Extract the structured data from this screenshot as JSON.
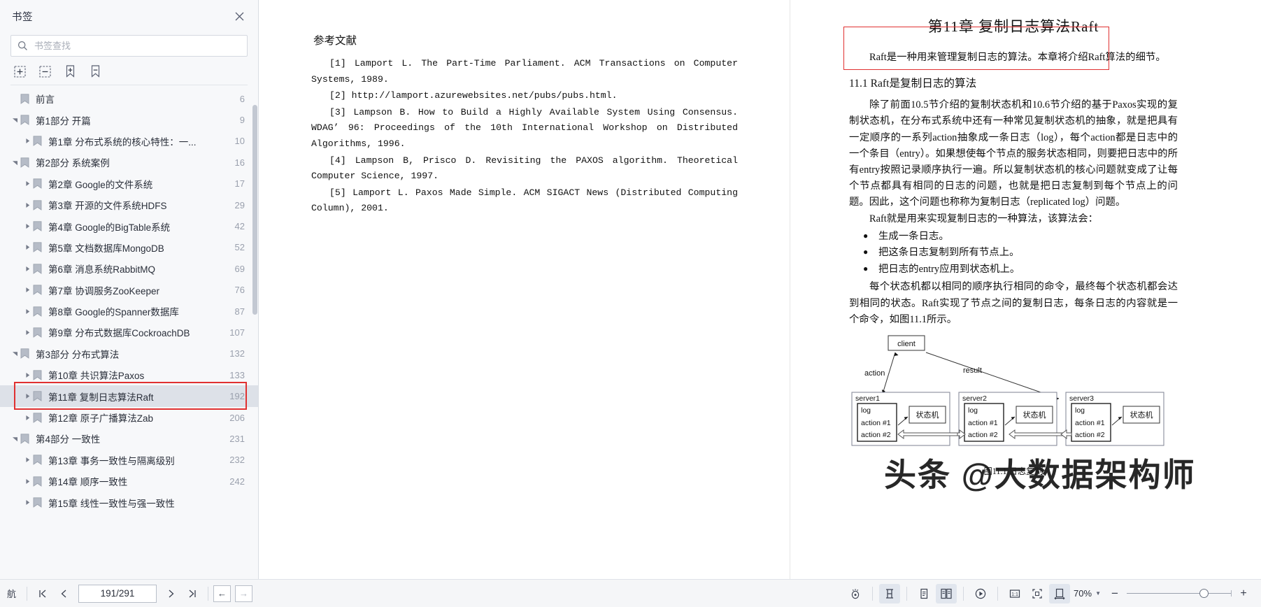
{
  "sidebar": {
    "title": "书签",
    "close_icon": "close-icon",
    "search": {
      "placeholder": "书签查找",
      "value": "",
      "icon": "search-icon"
    },
    "tools": [
      {
        "name": "expand-all-button",
        "icon": "box-plus-icon"
      },
      {
        "name": "collapse-all-button",
        "icon": "box-minus-icon"
      },
      {
        "name": "add-bookmark-button",
        "icon": "bookmark-plus-icon"
      },
      {
        "name": "remove-bookmark-button",
        "icon": "bookmark-minus-icon"
      }
    ],
    "items": [
      {
        "label": "前言",
        "page": "6",
        "level": 0,
        "twisty": "none",
        "selected": false
      },
      {
        "label": "第1部分 开篇",
        "page": "9",
        "level": 0,
        "twisty": "down",
        "selected": false
      },
      {
        "label": "第1章 分布式系统的核心特性：一...",
        "page": "10",
        "level": 2,
        "twisty": "right",
        "selected": false
      },
      {
        "label": "第2部分 系统案例",
        "page": "16",
        "level": 0,
        "twisty": "down",
        "selected": false
      },
      {
        "label": "第2章 Google的文件系统",
        "page": "17",
        "level": 2,
        "twisty": "right",
        "selected": false
      },
      {
        "label": "第3章 开源的文件系统HDFS",
        "page": "29",
        "level": 2,
        "twisty": "right",
        "selected": false
      },
      {
        "label": "第4章 Google的BigTable系统",
        "page": "42",
        "level": 2,
        "twisty": "right",
        "selected": false
      },
      {
        "label": "第5章 文档数据库MongoDB",
        "page": "52",
        "level": 2,
        "twisty": "right",
        "selected": false
      },
      {
        "label": "第6章 消息系统RabbitMQ",
        "page": "69",
        "level": 2,
        "twisty": "right",
        "selected": false
      },
      {
        "label": "第7章 协调服务ZooKeeper",
        "page": "76",
        "level": 2,
        "twisty": "right",
        "selected": false
      },
      {
        "label": "第8章 Google的Spanner数据库",
        "page": "87",
        "level": 2,
        "twisty": "right",
        "selected": false
      },
      {
        "label": "第9章 分布式数据库CockroachDB",
        "page": "107",
        "level": 2,
        "twisty": "right",
        "selected": false
      },
      {
        "label": "第3部分 分布式算法",
        "page": "132",
        "level": 0,
        "twisty": "down",
        "selected": false
      },
      {
        "label": "第10章 共识算法Paxos",
        "page": "133",
        "level": 2,
        "twisty": "right",
        "selected": false
      },
      {
        "label": "第11章 复制日志算法Raft",
        "page": "192",
        "level": 2,
        "twisty": "right",
        "selected": true
      },
      {
        "label": "第12章 原子广播算法Zab",
        "page": "206",
        "level": 2,
        "twisty": "right",
        "selected": false
      },
      {
        "label": "第4部分 一致性",
        "page": "231",
        "level": 0,
        "twisty": "down",
        "selected": false
      },
      {
        "label": "第13章 事务一致性与隔离级别",
        "page": "232",
        "level": 2,
        "twisty": "right",
        "selected": false
      },
      {
        "label": "第14章 顺序一致性",
        "page": "242",
        "level": 2,
        "twisty": "right",
        "selected": false
      },
      {
        "label": "第15章 线性一致性与强一致性",
        "page": "",
        "level": 2,
        "twisty": "right",
        "selected": false
      }
    ],
    "highlight_color": "#e03131"
  },
  "left_page": {
    "heading": "参考文献",
    "references": [
      "[1] Lamport L. The Part-Time Parliament. ACM Transactions on Computer Systems, 1989.",
      "[2] http://lamport.azurewebsites.net/pubs/pubs.html.",
      "[3] Lampson B. How to Build a Highly Available System Using Consensus. WDAG’ 96: Proceedings of the 10th International Workshop on Distributed Algorithms, 1996.",
      "[4] Lampson B, Prisco D. Revisiting the PAXOS algorithm. Theoretical Computer Science, 1997.",
      "[5] Lamport L. Paxos Made Simple. ACM SIGACT News (Distributed Computing Column), 2001."
    ]
  },
  "right_page": {
    "chapter_title": "第11章 复制日志算法Raft",
    "intro": "Raft是一种用来管理复制日志的算法。本章将介绍Raft算法的细节。",
    "section_heading": "11.1 Raft是复制日志的算法",
    "para1": "除了前面10.5节介绍的复制状态机和10.6节介绍的基于Paxos实现的复制状态机，在分布式系统中还有一种常见复制状态机的抽象，就是把具有一定顺序的一系列action抽象成一条日志（log），每个action都是日志中的一个条目（entry）。如果想使每个节点的服务状态相同，则要把日志中的所有entry按照记录顺序执行一遍。所以复制状态机的核心问题就变成了让每个节点都具有相同的日志的问题，也就是把日志复制到每个节点上的问题。因此，这个问题也称称为复制日志（replicated log）问题。",
    "para2": "Raft就是用来实现复制日志的一种算法，该算法会：",
    "bullets": [
      "生成一条日志。",
      "把这条日志复制到所有节点上。",
      "把日志的entry应用到状态机上。"
    ],
    "para3": "每个状态机都以相同的顺序执行相同的命令，最终每个状态机都会达到相同的状态。Raft实现了节点之间的复制日志，每条日志的内容就是一个命令，如图11.1所示。",
    "figure": {
      "caption": "图11.1 日志复制",
      "client_label": "client",
      "action_label": "action",
      "result_label": "result",
      "servers": [
        {
          "name": "server1",
          "log_label": "log",
          "entries": [
            "action #1",
            "action #2"
          ],
          "sm_label": "状态机"
        },
        {
          "name": "server2",
          "log_label": "log",
          "entries": [
            "action #1",
            "action #2"
          ],
          "sm_label": "状态机"
        },
        {
          "name": "server3",
          "log_label": "log",
          "entries": [
            "action #1",
            "action #2"
          ],
          "sm_label": "状态机"
        }
      ]
    },
    "watermark": "头条 @大数据架构师"
  },
  "bottom_bar": {
    "nav_label": "航",
    "first_page_icon": "first-page-icon",
    "prev_page_icon": "prev-page-icon",
    "page_indicator": "191/291",
    "next_page_icon": "next-page-icon",
    "last_page_icon": "last-page-icon",
    "back_icon": "back-arrow-icon",
    "forward_icon": "forward-arrow-icon",
    "right_tools": [
      {
        "name": "eye-protect-icon",
        "active": false
      },
      {
        "name": "fit-height-icon",
        "active": true
      },
      {
        "name": "single-page-icon",
        "active": false
      },
      {
        "name": "double-page-icon",
        "active": true
      },
      {
        "name": "play-slideshow-icon",
        "active": false
      },
      {
        "name": "actual-size-icon",
        "active": false
      },
      {
        "name": "fit-page-icon",
        "active": false
      },
      {
        "name": "fit-width-icon",
        "active": true
      }
    ],
    "zoom_value": "70%",
    "zoom_minus": "−",
    "zoom_plus": "+"
  }
}
